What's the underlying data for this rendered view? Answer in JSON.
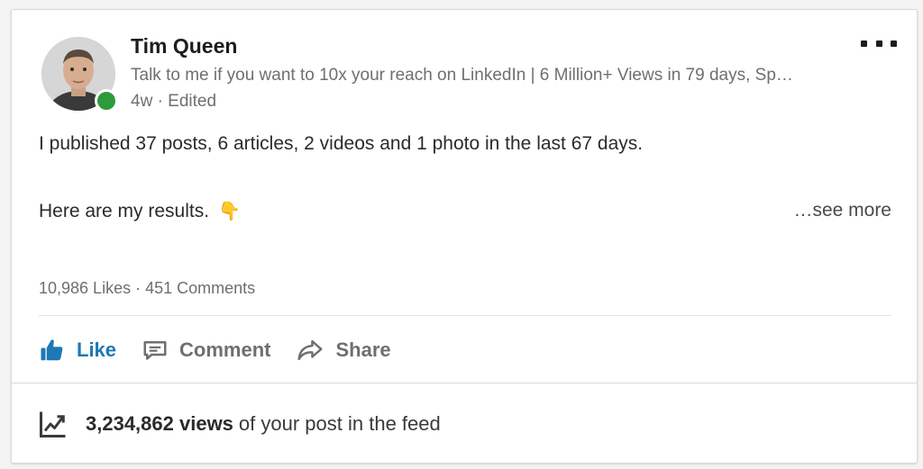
{
  "post": {
    "author": {
      "name": "Tim Queen",
      "headline": "Talk to me if you want to 10x your reach on LinkedIn | 6 Million+ Views in 79 days, Sp…",
      "meta": "4w · Edited",
      "online_status_color": "#2e9b3a"
    },
    "text": {
      "line1": "I published 37 posts, 6 articles, 2 videos and 1 photo in the last 67 days.",
      "line2": "Here are my results.",
      "emoji": "👇",
      "see_more": "…see more"
    },
    "social_counts": {
      "likes": "10,986 Likes",
      "separator": "·",
      "comments": "451 Comments"
    },
    "actions": {
      "like": "Like",
      "comment": "Comment",
      "share": "Share"
    },
    "views": {
      "count": "3,234,862 views",
      "suffix": "of your post in the feed"
    },
    "icons": {
      "more": "more-options-icon",
      "like": "thumbs-up-icon",
      "comment": "comment-icon",
      "share": "share-arrow-icon",
      "views": "trending-chart-icon"
    },
    "colors": {
      "accent": "#1d78b5",
      "muted_text": "#6f6f6f"
    }
  }
}
